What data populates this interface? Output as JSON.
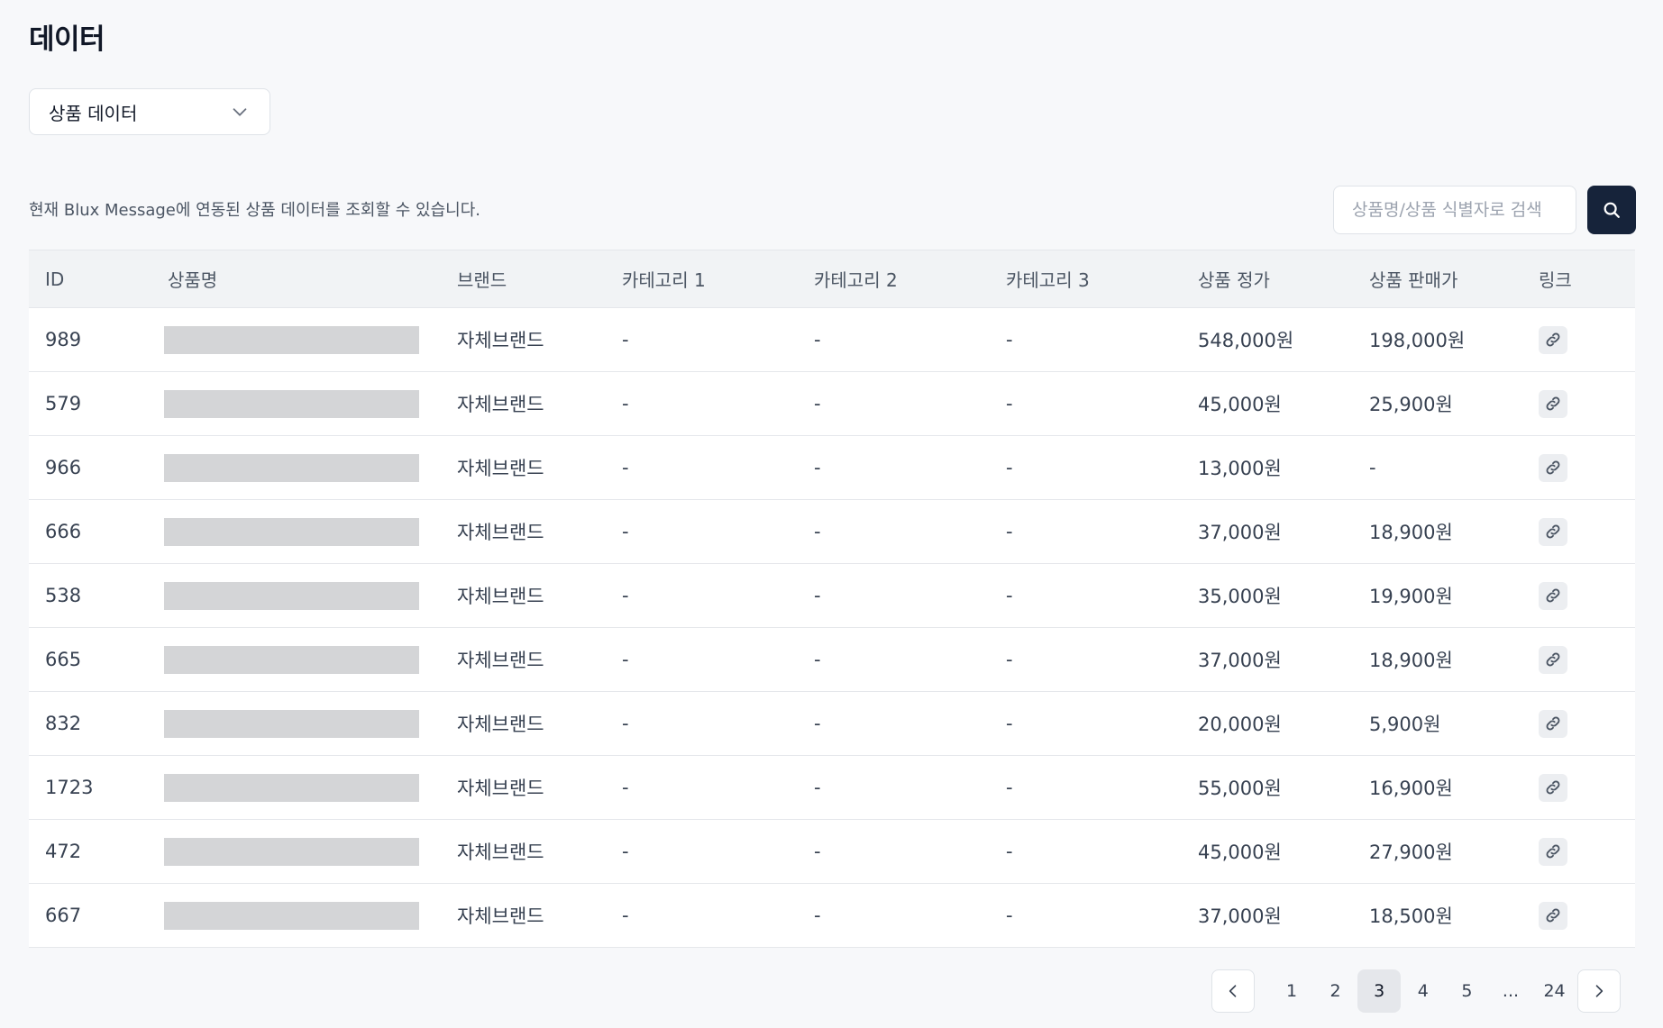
{
  "page": {
    "title": "데이터"
  },
  "dataset_select": {
    "selected": "상품 데이터",
    "icon": "chevron-down-icon"
  },
  "description": "현재 Blux Message에 연동된 상품 데이터를 조회할 수 있습니다.",
  "search": {
    "placeholder": "상품명/상품 식별자로 검색",
    "value": "",
    "button_icon": "search-icon"
  },
  "table": {
    "columns": [
      "ID",
      "상품명",
      "브랜드",
      "카테고리 1",
      "카테고리 2",
      "카테고리 3",
      "상품 정가",
      "상품 판매가",
      "링크"
    ],
    "rows": [
      {
        "id": "989",
        "brand": "자체브랜드",
        "cat1": "-",
        "cat2": "-",
        "cat3": "-",
        "price": "548,000원",
        "sale": "198,000원",
        "link_icon": "link-icon"
      },
      {
        "id": "579",
        "brand": "자체브랜드",
        "cat1": "-",
        "cat2": "-",
        "cat3": "-",
        "price": "45,000원",
        "sale": "25,900원",
        "link_icon": "link-icon"
      },
      {
        "id": "966",
        "brand": "자체브랜드",
        "cat1": "-",
        "cat2": "-",
        "cat3": "-",
        "price": "13,000원",
        "sale": "-",
        "link_icon": "link-icon"
      },
      {
        "id": "666",
        "brand": "자체브랜드",
        "cat1": "-",
        "cat2": "-",
        "cat3": "-",
        "price": "37,000원",
        "sale": "18,900원",
        "link_icon": "link-icon"
      },
      {
        "id": "538",
        "brand": "자체브랜드",
        "cat1": "-",
        "cat2": "-",
        "cat3": "-",
        "price": "35,000원",
        "sale": "19,900원",
        "link_icon": "link-icon"
      },
      {
        "id": "665",
        "brand": "자체브랜드",
        "cat1": "-",
        "cat2": "-",
        "cat3": "-",
        "price": "37,000원",
        "sale": "18,900원",
        "link_icon": "link-icon"
      },
      {
        "id": "832",
        "brand": "자체브랜드",
        "cat1": "-",
        "cat2": "-",
        "cat3": "-",
        "price": "20,000원",
        "sale": "5,900원",
        "link_icon": "link-icon"
      },
      {
        "id": "1723",
        "brand": "자체브랜드",
        "cat1": "-",
        "cat2": "-",
        "cat3": "-",
        "price": "55,000원",
        "sale": "16,900원",
        "link_icon": "link-icon"
      },
      {
        "id": "472",
        "brand": "자체브랜드",
        "cat1": "-",
        "cat2": "-",
        "cat3": "-",
        "price": "45,000원",
        "sale": "27,900원",
        "link_icon": "link-icon"
      },
      {
        "id": "667",
        "brand": "자체브랜드",
        "cat1": "-",
        "cat2": "-",
        "cat3": "-",
        "price": "37,000원",
        "sale": "18,500원",
        "link_icon": "link-icon"
      }
    ]
  },
  "pagination": {
    "prev_icon": "chevron-left-icon",
    "next_icon": "chevron-right-icon",
    "pages": [
      "1",
      "2",
      "3",
      "4",
      "5"
    ],
    "current": "3",
    "ellipsis": "...",
    "last": "24"
  },
  "colors": {
    "background": "#f7f8fa",
    "primary_button": "#16233a",
    "redacted_block": "#d4d5d7",
    "header_row": "#f1f3f5",
    "active_page": "#e5e7eb"
  }
}
